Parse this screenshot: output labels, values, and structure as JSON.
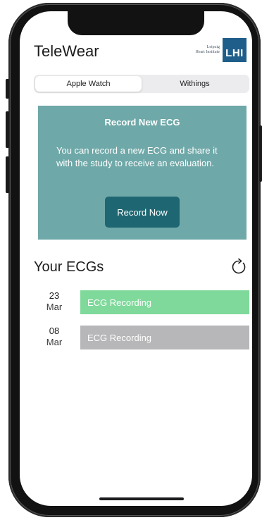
{
  "app": {
    "title": "TeleWear",
    "logo": {
      "line1": "Leipzig",
      "line2": "Heart Institute",
      "mark": "LHI",
      "color": "#1f5e8a"
    }
  },
  "tabs": [
    {
      "label": "Apple Watch",
      "active": true
    },
    {
      "label": "Withings",
      "active": false
    }
  ],
  "record_card": {
    "title": "Record New ECG",
    "text": "You can record a new ECG and share it with the study to receive an evaluation.",
    "button_label": "Record Now",
    "background": "#6fa8a8",
    "button_color": "#1e6772"
  },
  "ecg_section": {
    "title": "Your ECGs",
    "refresh_icon": "refresh-icon",
    "items": [
      {
        "day": "23",
        "month": "Mar",
        "label": "ECG Recording",
        "color": "#7ed99a"
      },
      {
        "day": "08",
        "month": "Mar",
        "label": "ECG Recording",
        "color": "#b7b7b9"
      }
    ]
  }
}
